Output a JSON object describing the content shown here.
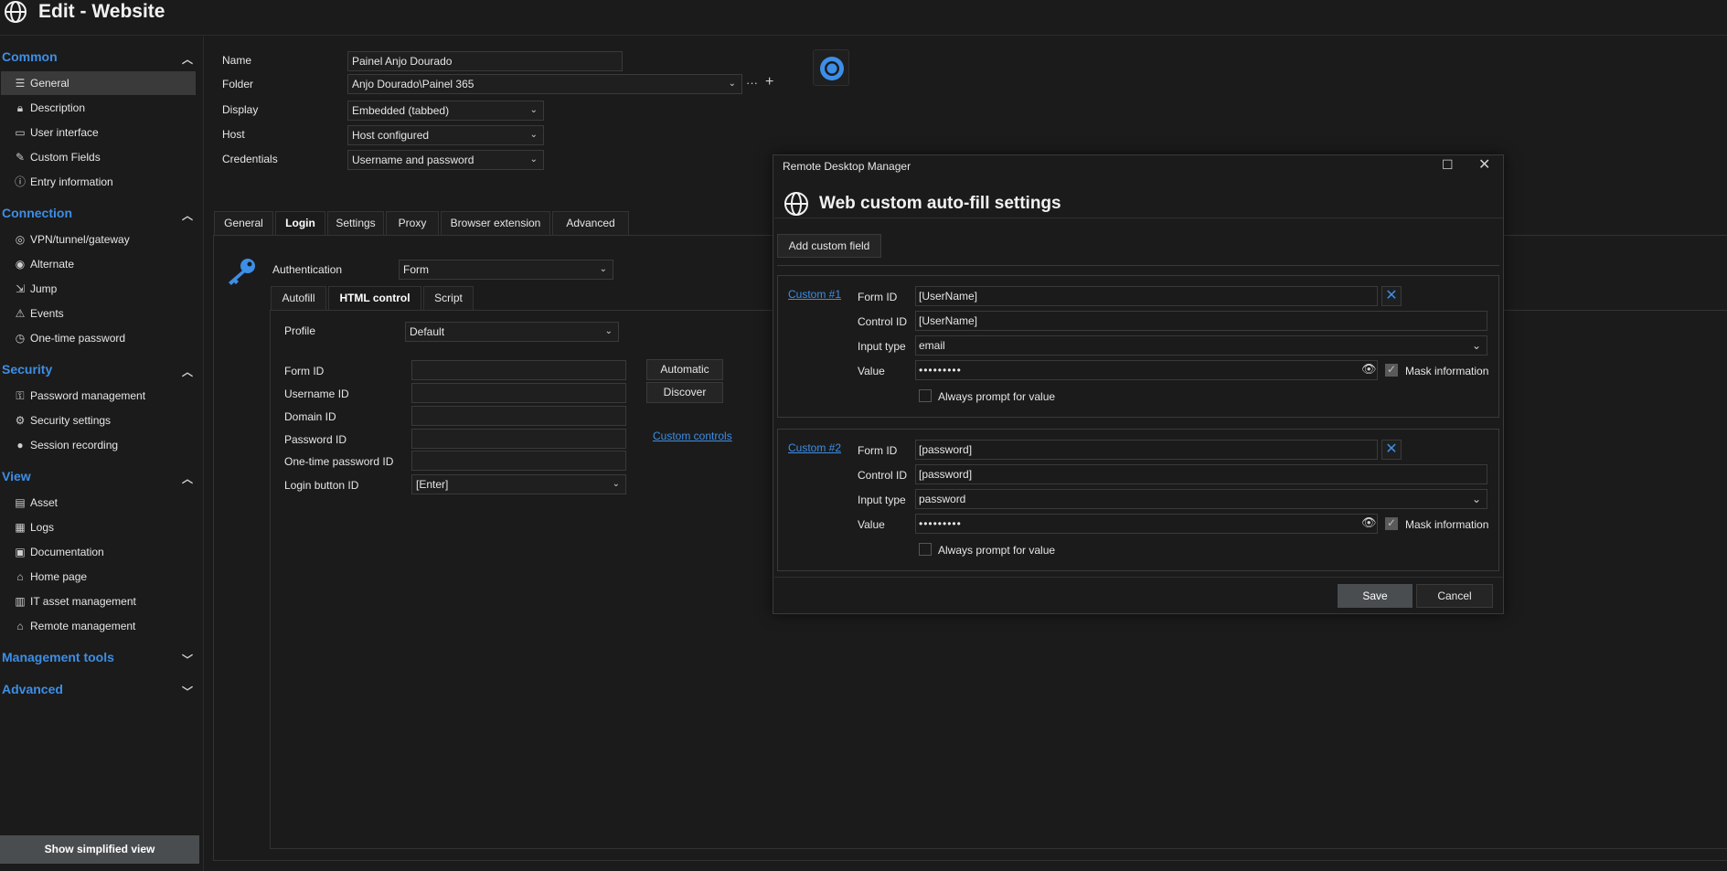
{
  "window": {
    "title": "Edit - Website"
  },
  "sidebar": {
    "sections": [
      {
        "title": "Common",
        "expanded": true,
        "items": [
          {
            "label": "General",
            "icon": "list-icon",
            "active": true
          },
          {
            "label": "Description",
            "icon": "lock-icon"
          },
          {
            "label": "User interface",
            "icon": "monitor-icon"
          },
          {
            "label": "Custom Fields",
            "icon": "custom-fields-icon"
          },
          {
            "label": "Entry information",
            "icon": "info-icon"
          }
        ]
      },
      {
        "title": "Connection",
        "expanded": true,
        "items": [
          {
            "label": "VPN/tunnel/gateway",
            "icon": "vpn-icon"
          },
          {
            "label": "Alternate",
            "icon": "alternate-icon"
          },
          {
            "label": "Jump",
            "icon": "jump-icon"
          },
          {
            "label": "Events",
            "icon": "warning-icon"
          },
          {
            "label": "One-time password",
            "icon": "clock-icon"
          }
        ]
      },
      {
        "title": "Security",
        "expanded": true,
        "items": [
          {
            "label": "Password management",
            "icon": "password-management-icon"
          },
          {
            "label": "Security settings",
            "icon": "security-settings-icon"
          },
          {
            "label": "Session recording",
            "icon": "record-icon"
          }
        ]
      },
      {
        "title": "View",
        "expanded": true,
        "items": [
          {
            "label": "Asset",
            "icon": "asset-icon"
          },
          {
            "label": "Logs",
            "icon": "logs-icon"
          },
          {
            "label": "Documentation",
            "icon": "documentation-icon"
          },
          {
            "label": "Home page",
            "icon": "home-icon"
          },
          {
            "label": "IT asset management",
            "icon": "it-asset-icon"
          },
          {
            "label": "Remote management",
            "icon": "remote-management-icon"
          }
        ]
      },
      {
        "title": "Management tools",
        "expanded": false,
        "items": []
      },
      {
        "title": "Advanced",
        "expanded": false,
        "items": []
      }
    ],
    "simplified_label": "Show simplified view"
  },
  "form": {
    "name_label": "Name",
    "name_value": "Painel Anjo Dourado",
    "folder_label": "Folder",
    "folder_value": "Anjo Dourado\\Painel 365",
    "display_label": "Display",
    "display_value": "Embedded (tabbed)",
    "host_label": "Host",
    "host_value": "Host configured",
    "credentials_label": "Credentials",
    "credentials_value": "Username and password",
    "folder_more": "···",
    "folder_add": "+"
  },
  "tabs": [
    "General",
    "Login",
    "Settings",
    "Proxy",
    "Browser extension",
    "Advanced"
  ],
  "active_tab": "Login",
  "login": {
    "auth_label": "Authentication",
    "auth_value": "Form",
    "subtabs": [
      "Autofill",
      "HTML control",
      "Script"
    ],
    "active_subtab": "HTML control",
    "profile_label": "Profile",
    "profile_value": "Default",
    "form_id_label": "Form ID",
    "username_id_label": "Username ID",
    "domain_id_label": "Domain ID",
    "password_id_label": "Password ID",
    "otp_id_label": "One-time password ID",
    "login_button_label": "Login button ID",
    "login_button_value": "[Enter]",
    "automatic_label": "Automatic",
    "discover_label": "Discover",
    "custom_controls_label": "Custom controls"
  },
  "dialog": {
    "window_title": "Remote Desktop Manager",
    "heading": "Web custom auto-fill settings",
    "add_label": "Add custom field",
    "fields": [
      {
        "link": "Custom #1",
        "form_id": "[UserName]",
        "control_id": "[UserName]",
        "input_type": "email",
        "value": "•••••••••"
      },
      {
        "link": "Custom #2",
        "form_id": "[password]",
        "control_id": "[password]",
        "input_type": "password",
        "value": "•••••••••"
      }
    ],
    "form_id_label": "Form ID",
    "control_id_label": "Control ID",
    "input_type_label": "Input type",
    "value_label": "Value",
    "mask_label": "Mask information",
    "prompt_label": "Always prompt for value",
    "save_label": "Save",
    "cancel_label": "Cancel"
  },
  "colors": {
    "accent": "#3d8ee6",
    "background": "#1b1b1b",
    "save_button": "#4a4d50"
  }
}
